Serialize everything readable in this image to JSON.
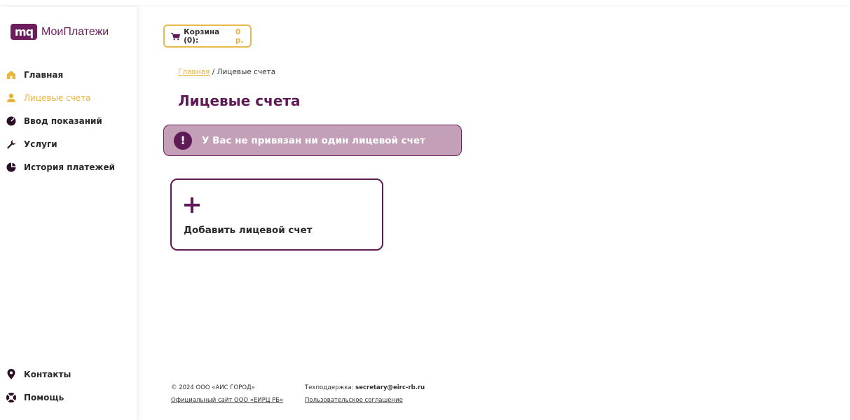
{
  "logo": {
    "mark": "mq",
    "text": "МоиПлатежи"
  },
  "sidebar": {
    "items": [
      {
        "label": "Главная",
        "icon": "home-icon"
      },
      {
        "label": "Лицевые счета",
        "icon": "user-icon",
        "active": true
      },
      {
        "label": "Ввод показаний",
        "icon": "gauge-icon"
      },
      {
        "label": "Услуги",
        "icon": "wrench-icon"
      },
      {
        "label": "История платежей",
        "icon": "pie-chart-icon"
      }
    ],
    "bottom_items": [
      {
        "label": "Контакты",
        "icon": "map-pin-icon"
      },
      {
        "label": "Помощь",
        "icon": "lifebuoy-icon"
      }
    ]
  },
  "cart": {
    "label": "Корзина (0):",
    "sum": "0 р."
  },
  "breadcrumb": {
    "home": "Главная",
    "separator": " / ",
    "current": "Лицевые счета"
  },
  "page_title": "Лицевые счета",
  "alert": {
    "icon": "!",
    "text": "У Вас не привязан ни один лицевой счет"
  },
  "add_card": {
    "label": "Добавить лицевой счет"
  },
  "footer": {
    "copyright": "© 2024 ООО «АИС ГОРОД»",
    "official_site": "Официальный сайт ООО «ЕИРЦ РБ»",
    "support_label": "Техподдержка: ",
    "support_email": "secretary@eirc-rb.ru",
    "agreement": "Пользовательское соглашение"
  },
  "colors": {
    "brand": "#6b1d5e",
    "accent": "#e9b43b",
    "alert_bg": "#c3a0b8"
  }
}
